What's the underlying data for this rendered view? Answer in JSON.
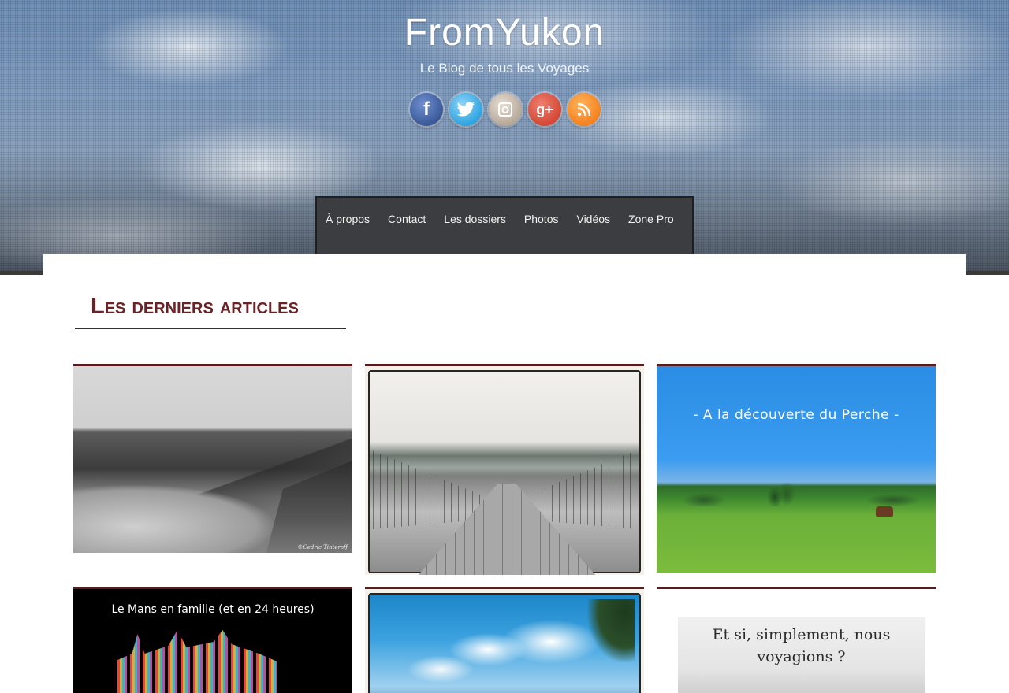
{
  "site": {
    "title": "FromYukon",
    "tagline": "Le Blog de tous les Voyages"
  },
  "social": [
    {
      "name": "facebook",
      "icon": "facebook-icon",
      "glyph": "f"
    },
    {
      "name": "twitter",
      "icon": "twitter-icon"
    },
    {
      "name": "instagram",
      "icon": "instagram-icon"
    },
    {
      "name": "google-plus",
      "icon": "google-plus-icon",
      "glyph": "g+"
    },
    {
      "name": "rss",
      "icon": "rss-icon"
    }
  ],
  "nav": {
    "items": [
      {
        "label": "À propos"
      },
      {
        "label": "Contact"
      },
      {
        "label": "Les dossiers"
      },
      {
        "label": "Photos"
      },
      {
        "label": "Vidéos"
      },
      {
        "label": "Zone Pro"
      }
    ]
  },
  "section": {
    "title": "Les derniers articles"
  },
  "articles": [
    {
      "image_text": "",
      "credit": "©Cedric Tinteroff"
    },
    {
      "image_text": ""
    },
    {
      "image_text": "- A la découverte du Perche -"
    },
    {
      "image_text": "Le Mans en famille (et en 24 heures)"
    },
    {
      "image_text": ""
    },
    {
      "image_text": "Et si, simplement, nous voyagions ?"
    }
  ],
  "colors": {
    "accent": "#6b2226",
    "card_border": "#5a1b1f",
    "nav_bg": "#3c3d40",
    "facebook": "#3b5998",
    "twitter": "#2fa4e0",
    "instagram": "#b7a99a",
    "google_plus": "#d34836",
    "rss": "#f58220"
  }
}
